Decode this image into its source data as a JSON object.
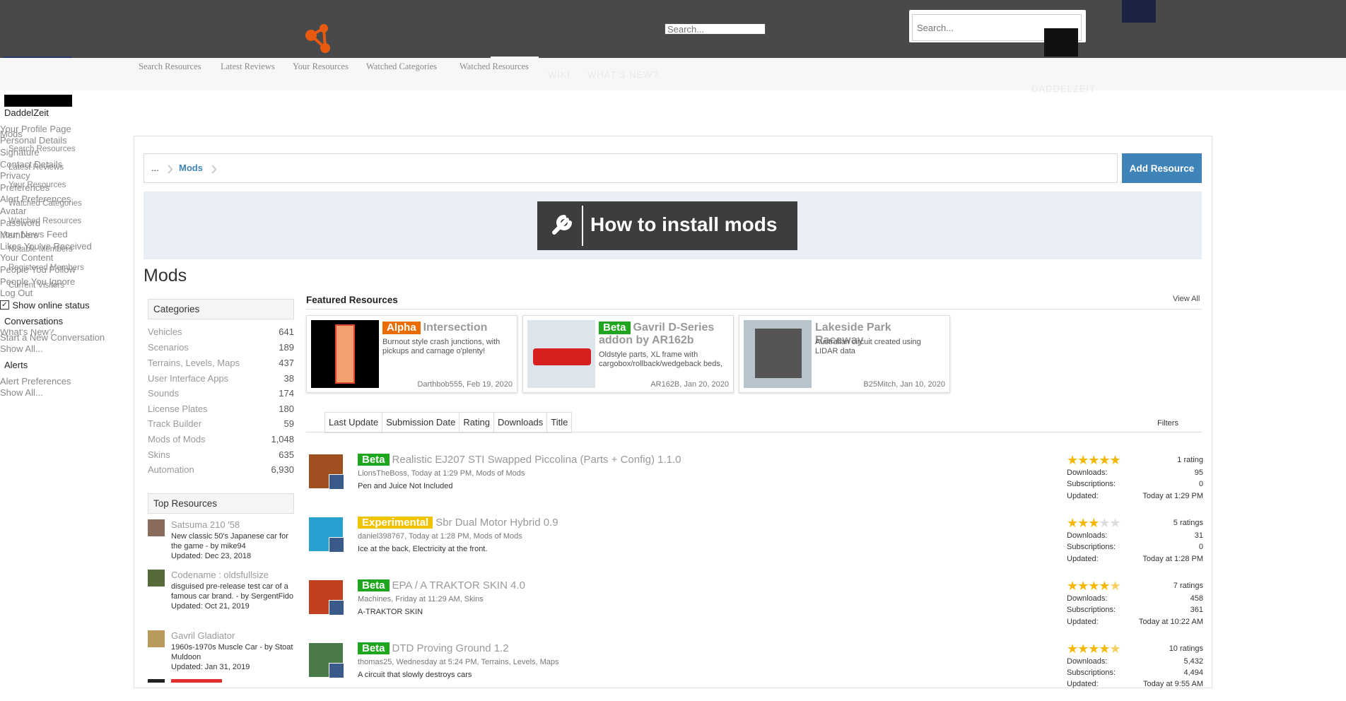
{
  "header": {
    "search_small_placeholder": "Search...",
    "search_big_placeholder": "Search...",
    "subnav": [
      "Search Resources",
      "Latest Reviews",
      "Your Resources",
      "Watched Categories",
      "Watched Resources"
    ],
    "ghost_nav": [
      "WIKI",
      "WHAT'S NEW?"
    ],
    "ghost_user": "DADDELZEIT"
  },
  "user_menu": {
    "username": "DaddelZeit",
    "items": [
      "Your Profile Page",
      "Personal Details",
      "Signature",
      "Contact Details",
      "Privacy",
      "Preferences",
      "Alert Preferences",
      "Avatar",
      "Password",
      "Your News Feed",
      "Likes You've Received",
      "Your Content",
      "People You Follow",
      "People You Ignore",
      "Log Out"
    ],
    "show_online": "Show online status",
    "conversations_head": "Conversations",
    "conversations_items": [
      "Start a New Conversation",
      "Show All..."
    ],
    "alerts_head": "Alerts",
    "alerts_items": [
      "Alert Preferences",
      "Show All..."
    ]
  },
  "overlay_menus": {
    "mods": "Mods",
    "mods_items": [
      "Search Resources",
      "Latest Reviews",
      "Your Resources",
      "Watched Categories",
      "Watched Resources"
    ],
    "members": "Members",
    "members_items": [
      "Notable Members",
      "Registered Members",
      "Current Visitors"
    ],
    "whats_new": "What's New?"
  },
  "breadcrumb": {
    "ellipsis": "...",
    "current": "Mods"
  },
  "add_resource": "Add Resource",
  "banner_text": "How to install mods",
  "page_title": "Mods",
  "categories": {
    "title": "Categories",
    "items": [
      {
        "name": "Vehicles",
        "count": "641"
      },
      {
        "name": "Scenarios",
        "count": "189"
      },
      {
        "name": "Terrains, Levels, Maps",
        "count": "437"
      },
      {
        "name": "User Interface Apps",
        "count": "38"
      },
      {
        "name": "Sounds",
        "count": "174"
      },
      {
        "name": "License Plates",
        "count": "180"
      },
      {
        "name": "Track Builder",
        "count": "59"
      },
      {
        "name": "Mods of Mods",
        "count": "1,048"
      },
      {
        "name": "Skins",
        "count": "635"
      },
      {
        "name": "Automation",
        "count": "6,930"
      }
    ]
  },
  "featured": {
    "title": "Featured Resources",
    "view_all": "View All",
    "cards": [
      {
        "badge": "Alpha",
        "title": "Intersection",
        "desc": "Burnout style crash junctions, with pickups and carnage o'plenty!",
        "meta": "Darthbob555, Feb 19, 2020"
      },
      {
        "badge": "Beta",
        "title": "Gavril D-Series addon by AR162b",
        "desc": "Oldstyle parts, XL frame with cargobox/rollback/wedgeback beds,",
        "meta": "AR162B, Jan 20, 2020"
      },
      {
        "badge": "",
        "title": "Lakeside Park Raceway",
        "desc": "Australian circuit created using LIDAR data",
        "meta": "B25Mitch, Jan 10, 2020"
      }
    ]
  },
  "tabs": [
    "Last Update",
    "Submission Date",
    "Rating",
    "Downloads",
    "Title"
  ],
  "filters": "Filters",
  "resources": [
    {
      "badge": "Beta",
      "title": "Realistic EJ207 STI Swapped Piccolina (Parts + Config)",
      "version": "1.1.0",
      "meta": "LionsTheBoss, Today at 1:29 PM, Mods of Mods",
      "tagline": "Pen and Juice Not Included",
      "rating": 5,
      "ratings": "1 rating",
      "downloads": "95",
      "subscriptions": "0",
      "updated": "Today at 1:29 PM"
    },
    {
      "badge": "Experimental",
      "title": "Sbr Dual Motor Hybrid",
      "version": "0.9",
      "meta": "daniel398767, Today at 1:28 PM, Mods of Mods",
      "tagline": "Ice at the back, Electricity at the front.",
      "rating": 3,
      "ratings": "5 ratings",
      "downloads": "31",
      "subscriptions": "0",
      "updated": "Today at 1:28 PM"
    },
    {
      "badge": "Beta",
      "title": "EPA / A TRAKTOR SKIN",
      "version": "4.0",
      "meta": "Machines, Friday at 11:29 AM, Skins",
      "tagline": "A-TRAKTOR SKIN",
      "rating": 4.5,
      "ratings": "7 ratings",
      "downloads": "458",
      "subscriptions": "361",
      "updated": "Today at 10:22 AM"
    },
    {
      "badge": "Beta",
      "title": "DTD Proving Ground",
      "version": "1.2",
      "meta": "thomas25, Wednesday at 5:24 PM, Terrains, Levels, Maps",
      "tagline": "A circuit that slowly destroys cars",
      "rating": 4.5,
      "ratings": "10 ratings",
      "downloads": "5,432",
      "subscriptions": "4,494",
      "updated": "Today at 9:55 AM"
    }
  ],
  "labels": {
    "downloads": "Downloads:",
    "subscriptions": "Subscriptions:",
    "updated": "Updated:"
  },
  "top_resources": {
    "title": "Top Resources",
    "items": [
      {
        "title": "Satsuma 210 '58",
        "desc": "New classic 50's Japanese car for the game - by mike94",
        "updated": "Updated: Dec 23, 2018"
      },
      {
        "title": "Codename : oldsfullsize",
        "desc": "disguised pre-release test car of a famous car brand. - by SergentFido",
        "updated": "Updated: Oct 21, 2019"
      },
      {
        "title": "Gavril Gladiator",
        "desc": "1960s-1970s Muscle Car - by Stoat Muldoon",
        "updated": "Updated: Jan 31, 2019"
      }
    ]
  },
  "colors": {
    "accent": "#3f84b8",
    "beta": "#1fa61f",
    "alpha": "#e86c00",
    "experimental": "#f0c300",
    "topbar": "#47494b"
  }
}
